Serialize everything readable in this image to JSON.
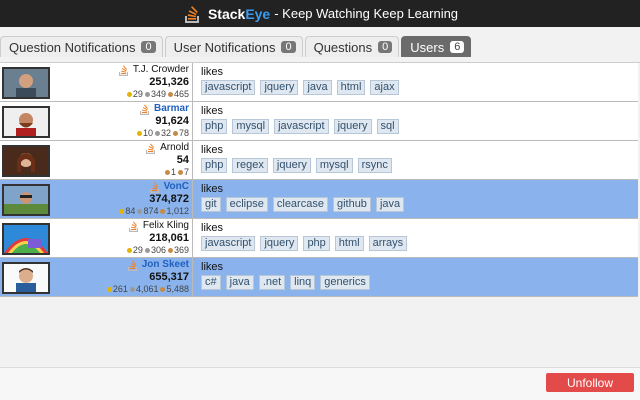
{
  "header": {
    "brand_stack": "Stack",
    "brand_eye": "Eye",
    "tagline": "- Keep Watching Keep Learning"
  },
  "tabs": [
    {
      "label": "Question Notifications",
      "count": "0",
      "active": false
    },
    {
      "label": "User Notifications",
      "count": "0",
      "active": false
    },
    {
      "label": "Questions",
      "count": "0",
      "active": false
    },
    {
      "label": "Users",
      "count": "6",
      "active": true
    }
  ],
  "likes_label": "likes",
  "users": [
    {
      "name": "T.J. Crowder",
      "rep": "251,326",
      "gold": "29",
      "silver": "349",
      "bronze": "465",
      "tags": [
        "javascript",
        "jquery",
        "java",
        "html",
        "ajax"
      ],
      "highlight": false,
      "name_style": "normal"
    },
    {
      "name": "Barmar",
      "rep": "91,624",
      "gold": "10",
      "silver": "32",
      "bronze": "78",
      "tags": [
        "php",
        "mysql",
        "javascript",
        "jquery",
        "sql"
      ],
      "highlight": false,
      "name_style": "blue"
    },
    {
      "name": "Arnold",
      "rep": "54",
      "gold": "",
      "silver": "",
      "bronze": "1",
      "bronze2": "7",
      "tags": [
        "php",
        "regex",
        "jquery",
        "mysql",
        "rsync"
      ],
      "highlight": false,
      "name_style": "normal"
    },
    {
      "name": "VonC",
      "rep": "374,872",
      "gold": "84",
      "silver": "874",
      "bronze": "1,012",
      "tags": [
        "git",
        "eclipse",
        "clearcase",
        "github",
        "java"
      ],
      "highlight": true,
      "name_style": "blue"
    },
    {
      "name": "Felix Kling",
      "rep": "218,061",
      "gold": "29",
      "silver": "306",
      "bronze": "369",
      "tags": [
        "javascript",
        "jquery",
        "php",
        "html",
        "arrays"
      ],
      "highlight": false,
      "name_style": "normal"
    },
    {
      "name": "Jon Skeet",
      "rep": "655,317",
      "gold": "261",
      "silver": "4,061",
      "bronze": "5,488",
      "tags": [
        "c#",
        "java",
        ".net",
        "linq",
        "generics"
      ],
      "highlight": true,
      "name_style": "blue"
    }
  ],
  "footer": {
    "unfollow_label": "Unfollow"
  },
  "colors": {
    "header_bg": "#222222",
    "highlight_row": "#8ab3ee",
    "unfollow_btn": "#e34a4a",
    "brand_eye": "#3a9bf0"
  }
}
